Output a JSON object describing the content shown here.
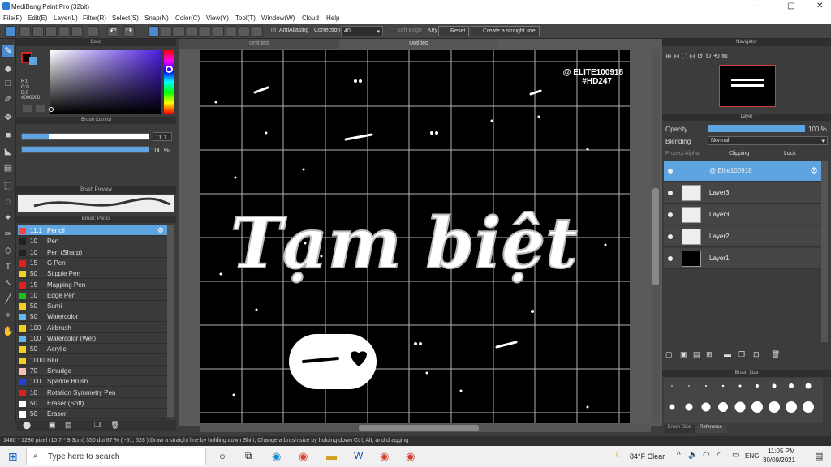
{
  "app": {
    "title": "MediBang Paint Pro (32bit)"
  },
  "menu": [
    "File(F)",
    "Edit(E)",
    "Layer(L)",
    "Filter(R)",
    "Select(S)",
    "Snap(N)",
    "Color(C)",
    "View(Y)",
    "Tool(T)",
    "Window(W)",
    "Cloud",
    "Help"
  ],
  "toolbar": {
    "antialias": "AntiAliasing",
    "correction_label": "Correction",
    "correction_value": "40",
    "soft_edge": "Soft Edge",
    "key": "Key",
    "reset": "Reset",
    "straight_line": "Create a straight line"
  },
  "color_panel": {
    "title": "Color",
    "r": "R:0",
    "g": "G:0",
    "b": "B:0",
    "hex": "#000000"
  },
  "brush_control": {
    "title": "Brush Control",
    "size": "11.1",
    "opacity": "100 %"
  },
  "brush_preview": {
    "title": "Brush Preview"
  },
  "brush_list": {
    "title": "Brush: Pencil",
    "items": [
      {
        "size": "11.1",
        "name": "Pencil",
        "color": "#ff4040"
      },
      {
        "size": "10",
        "name": "Pen",
        "color": "#202020"
      },
      {
        "size": "10",
        "name": "Pen (Sharp)",
        "color": "#202020"
      },
      {
        "size": "15",
        "name": "G Pen",
        "color": "#e02020"
      },
      {
        "size": "50",
        "name": "Stipple Pen",
        "color": "#f0d020"
      },
      {
        "size": "15",
        "name": "Mapping Pen",
        "color": "#e02020"
      },
      {
        "size": "10",
        "name": "Edge Pen",
        "color": "#20c020"
      },
      {
        "size": "50",
        "name": "Sumi",
        "color": "#f0d020"
      },
      {
        "size": "50",
        "name": "Watercolor",
        "color": "#60b8f0"
      },
      {
        "size": "100",
        "name": "Airbrush",
        "color": "#f0d020"
      },
      {
        "size": "100",
        "name": "Watercolor (Wet)",
        "color": "#60b8f0"
      },
      {
        "size": "50",
        "name": "Acrylic",
        "color": "#f0d020"
      },
      {
        "size": "1000",
        "name": "Blur",
        "color": "#f0d020"
      },
      {
        "size": "70",
        "name": "Smudge",
        "color": "#f0c0b0"
      },
      {
        "size": "100",
        "name": "Sparkle Brush",
        "color": "#2040e0"
      },
      {
        "size": "10",
        "name": "Rotation Symmetry Pen",
        "color": "#e02020"
      },
      {
        "size": "50",
        "name": "Eraser (Soft)",
        "color": "#ffffff"
      },
      {
        "size": "50",
        "name": "Eraser",
        "color": "#ffffff"
      }
    ]
  },
  "tabs": {
    "left": "Untitled",
    "right": "Untitled"
  },
  "canvas": {
    "watermark_line1": "@ ELITE100918",
    "watermark_line2": "#HD247",
    "title_text": "Tạm biệt"
  },
  "navigator": {
    "title": "Navigator"
  },
  "layer_panel": {
    "title": "Layer",
    "opacity_label": "Opacity",
    "opacity_value": "100 %",
    "blending_label": "Blending",
    "blending_value": "Normal",
    "protect_alpha": "Protect Alpha",
    "clipping": "Clipping",
    "lock": "Lock",
    "layers": [
      "@ Elite100918",
      "Layer3",
      "Layer3",
      "Layer2",
      "Layer1"
    ]
  },
  "brush_size": {
    "title": "Brush Size",
    "tab1": "Brush Size",
    "tab2": "Reference",
    "row1": [
      "",
      "",
      "",
      "1.5",
      "2",
      "3",
      "5",
      "7",
      "10",
      "12"
    ],
    "row2": [
      "15",
      "20",
      "25",
      "30",
      "40",
      "50",
      "70",
      "100",
      "150"
    ]
  },
  "status": "1480 * 1280 pixel  (10.7 * 9.3cm)  350 dpi  67 %  ( -61, 528 )  Draw a straight line by holding down Shift, Change a brush size by holding down Ctrl, Alt, and dragging",
  "taskbar": {
    "search": "Type here to search",
    "weather": "84°F  Clear",
    "lang": "ENG",
    "time": "11:05 PM",
    "date": "30/09/2021"
  }
}
